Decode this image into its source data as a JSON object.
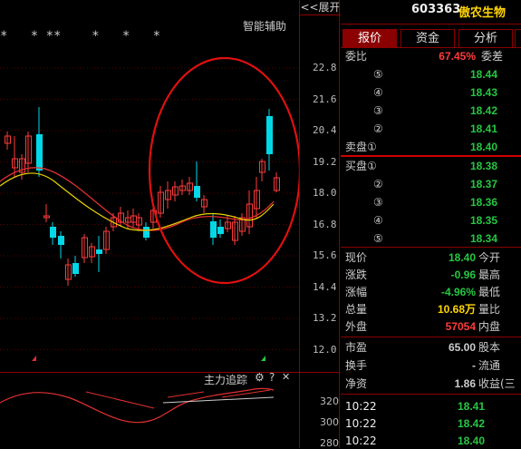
{
  "header": {
    "expand_label": "<<展开",
    "assist_label": "智能辅助",
    "stock_code": "603363",
    "stock_name": "傲农生物"
  },
  "chart": {
    "markers": "*   * **    *   *   *",
    "y_labels": [
      "22.8",
      "21.6",
      "20.4",
      "19.2",
      "18.0",
      "16.8",
      "15.6",
      "14.4",
      "13.2",
      "12.0"
    ],
    "indicator_label": "主力追踪",
    "indicator_gear": "⚙",
    "indicator_help": "?",
    "indicator_close": "✕",
    "indicator_y_labels": [
      "320",
      "300",
      "280"
    ]
  },
  "tabs": [
    {
      "label": "报价",
      "active": true
    },
    {
      "label": "资金",
      "active": false
    },
    {
      "label": "分析",
      "active": false
    }
  ],
  "quote": {
    "ratio_label": "委比",
    "ratio_value": "67.45%",
    "diff_label": "委差",
    "asks": [
      {
        "num": "⑤",
        "price": "18.44"
      },
      {
        "num": "④",
        "price": "18.43"
      },
      {
        "num": "③",
        "price": "18.42"
      },
      {
        "num": "②",
        "price": "18.41"
      },
      {
        "num": "卖盘①",
        "price": "18.40"
      }
    ],
    "bids": [
      {
        "num": "买盘①",
        "price": "18.38"
      },
      {
        "num": "②",
        "price": "18.37"
      },
      {
        "num": "③",
        "price": "18.36"
      },
      {
        "num": "④",
        "price": "18.35"
      },
      {
        "num": "⑤",
        "price": "18.34"
      }
    ],
    "stats": [
      {
        "label": "现价",
        "value": "18.40",
        "label2": "今开",
        "color": "#26c742"
      },
      {
        "label": "涨跌",
        "value": "-0.96",
        "label2": "最高",
        "color": "#26c742"
      },
      {
        "label": "涨幅",
        "value": "-4.96%",
        "label2": "最低",
        "color": "#26c742"
      },
      {
        "label": "总量",
        "value": "10.68万",
        "label2": "量比",
        "color": "#ffd400"
      },
      {
        "label": "外盘",
        "value": "57054",
        "label2": "内盘",
        "color": "#ff3b3b"
      }
    ],
    "stats2": [
      {
        "label": "市盈",
        "value": "65.00",
        "label2": "股本",
        "color": "#cccccc"
      },
      {
        "label": "换手",
        "value": "-",
        "label2": "流通",
        "color": "#cccccc"
      },
      {
        "label": "净资",
        "value": "1.86",
        "label2": "收益(三",
        "color": "#cccccc"
      }
    ]
  },
  "ticks": [
    {
      "time": "10:22",
      "price": "18.41"
    },
    {
      "time": "10:22",
      "price": "18.42"
    },
    {
      "time": "10:22",
      "price": "18.40"
    }
  ],
  "colors": {
    "up": "#ff3b3b",
    "down": "#00d8e8",
    "ma_yellow": "#e8d200",
    "ma_red": "#e03030",
    "frame": "#8b0000"
  }
}
